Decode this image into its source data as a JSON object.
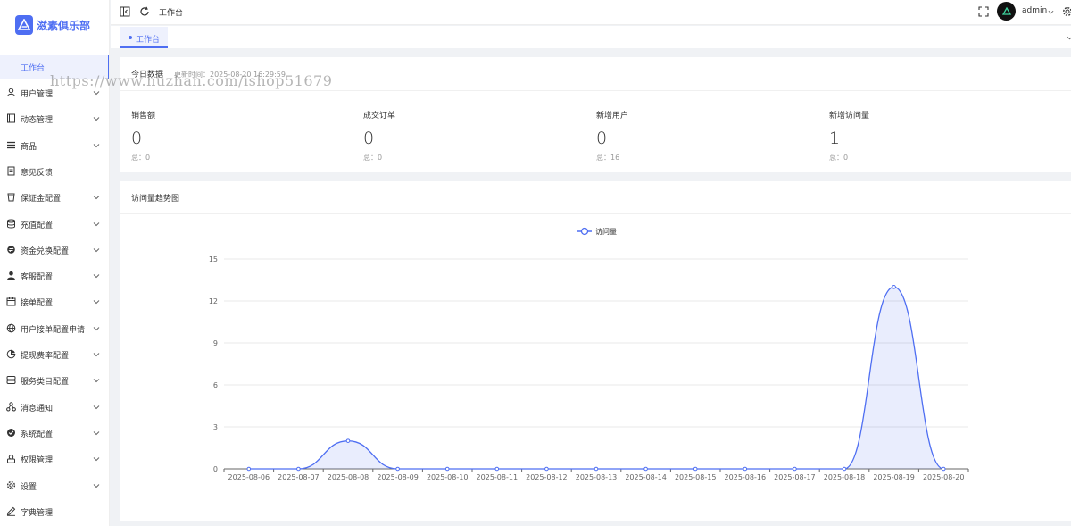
{
  "app": {
    "logo_text": "滋素俱乐部",
    "accent": "#4e6ef2"
  },
  "sidebar": {
    "active_item": "工作台",
    "items": [
      {
        "label": "用户管理",
        "icon": "user-icon",
        "has_children": true
      },
      {
        "label": "动态管理",
        "icon": "book-icon",
        "has_children": true
      },
      {
        "label": "商品",
        "icon": "list-icon",
        "has_children": true
      },
      {
        "label": "意见反馈",
        "icon": "document-icon",
        "has_children": false
      },
      {
        "label": "保证金配置",
        "icon": "cup-icon",
        "has_children": true
      },
      {
        "label": "充值配置",
        "icon": "database-icon",
        "has_children": true
      },
      {
        "label": "资金兑换配置",
        "icon": "exchange-icon",
        "has_children": true
      },
      {
        "label": "客服配置",
        "icon": "person-filled-icon",
        "has_children": true
      },
      {
        "label": "接单配置",
        "icon": "calendar-icon",
        "has_children": true
      },
      {
        "label": "用户接单配置申请",
        "icon": "globe-icon",
        "has_children": true
      },
      {
        "label": "提现费率配置",
        "icon": "pie-icon",
        "has_children": true
      },
      {
        "label": "服务类目配置",
        "icon": "server-icon",
        "has_children": true
      },
      {
        "label": "消息通知",
        "icon": "share-icon",
        "has_children": true
      },
      {
        "label": "系统配置",
        "icon": "check-circle-icon",
        "has_children": true
      },
      {
        "label": "权限管理",
        "icon": "key-icon",
        "has_children": true
      },
      {
        "label": "设置",
        "icon": "gear-icon",
        "has_children": true
      },
      {
        "label": "字典管理",
        "icon": "pen-icon",
        "has_children": false
      }
    ]
  },
  "header": {
    "breadcrumb": "工作台",
    "username": "admin"
  },
  "tabs": [
    {
      "label": "工作台"
    }
  ],
  "stats": {
    "title": "今日数据",
    "update_time": "更新时间：2025-08-20 16:29:59",
    "items": [
      {
        "label": "销售额",
        "value": "0",
        "total": "总：0"
      },
      {
        "label": "成交订单",
        "value": "0",
        "total": "总：0"
      },
      {
        "label": "新增用户",
        "value": "0",
        "total": "总：16"
      },
      {
        "label": "新增访问量",
        "value": "1",
        "total": "总：0"
      }
    ]
  },
  "watermark": "https://www.huzhan.com/ishop51679",
  "chart_data": {
    "type": "area",
    "title": "访问量趋势图",
    "legend": [
      "访问量"
    ],
    "legend_position": "top-center",
    "grid": true,
    "color": "#4e6ef2",
    "ylim": [
      0,
      15
    ],
    "yticks": [
      0,
      3,
      6,
      9,
      12,
      15
    ],
    "categories": [
      "2025-08-06",
      "2025-08-07",
      "2025-08-08",
      "2025-08-09",
      "2025-08-10",
      "2025-08-11",
      "2025-08-12",
      "2025-08-13",
      "2025-08-14",
      "2025-08-15",
      "2025-08-16",
      "2025-08-17",
      "2025-08-18",
      "2025-08-19",
      "2025-08-20"
    ],
    "series": [
      {
        "name": "访问量",
        "values": [
          0,
          0,
          2,
          0,
          0,
          0,
          0,
          0,
          0,
          0,
          0,
          0,
          0,
          13,
          0
        ]
      }
    ]
  }
}
